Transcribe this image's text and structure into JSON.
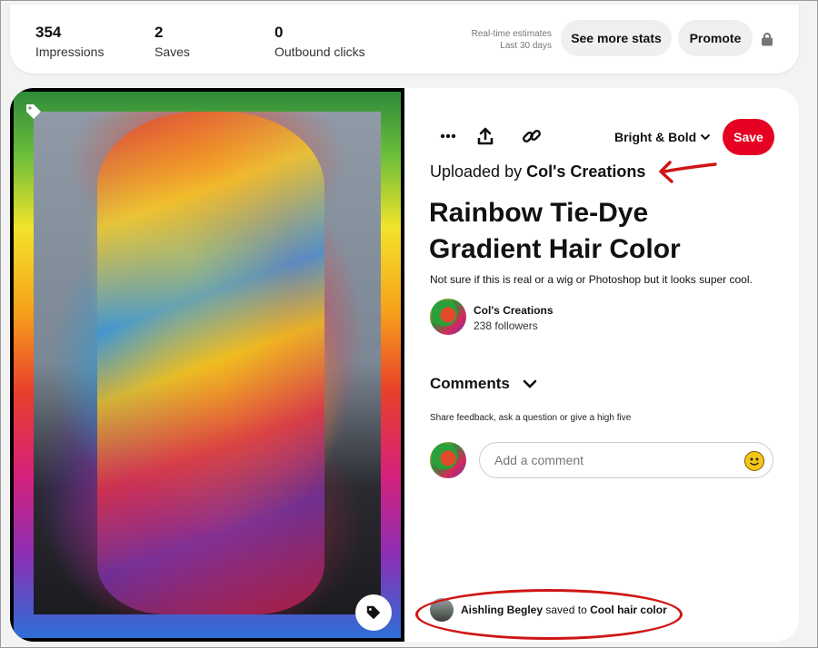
{
  "stats": {
    "impressions_value": "354",
    "impressions_label": "Impressions",
    "saves_value": "2",
    "saves_label": "Saves",
    "outbound_value": "0",
    "outbound_label": "Outbound clicks",
    "estimates_line1": "Real-time estimates",
    "estimates_line2": "Last 30 days",
    "see_more_label": "See more stats",
    "promote_label": "Promote"
  },
  "pin": {
    "board_name": "Bright & Bold",
    "save_label": "Save",
    "uploaded_prefix": "Uploaded by",
    "uploaded_by": "Col's Creations",
    "title": "Rainbow Tie-Dye Gradient Hair Color",
    "description": "Not sure if this is real or a wig or Photoshop but it looks super cool.",
    "creator_name": "Col's Creations",
    "creator_followers": "238 followers"
  },
  "comments": {
    "heading": "Comments",
    "hint": "Share feedback, ask a question or give a high five",
    "placeholder": "Add a comment"
  },
  "activity": {
    "user": "Aishling Begley",
    "action": "saved to",
    "board": "Cool hair color"
  },
  "colors": {
    "save_red": "#e60023",
    "annotation_red": "#d01515",
    "pill_gray": "#efefef"
  },
  "icons": [
    "more-icon",
    "share-icon",
    "link-icon",
    "chevron-down-icon",
    "lock-icon",
    "tag-icon",
    "emoji-icon"
  ]
}
